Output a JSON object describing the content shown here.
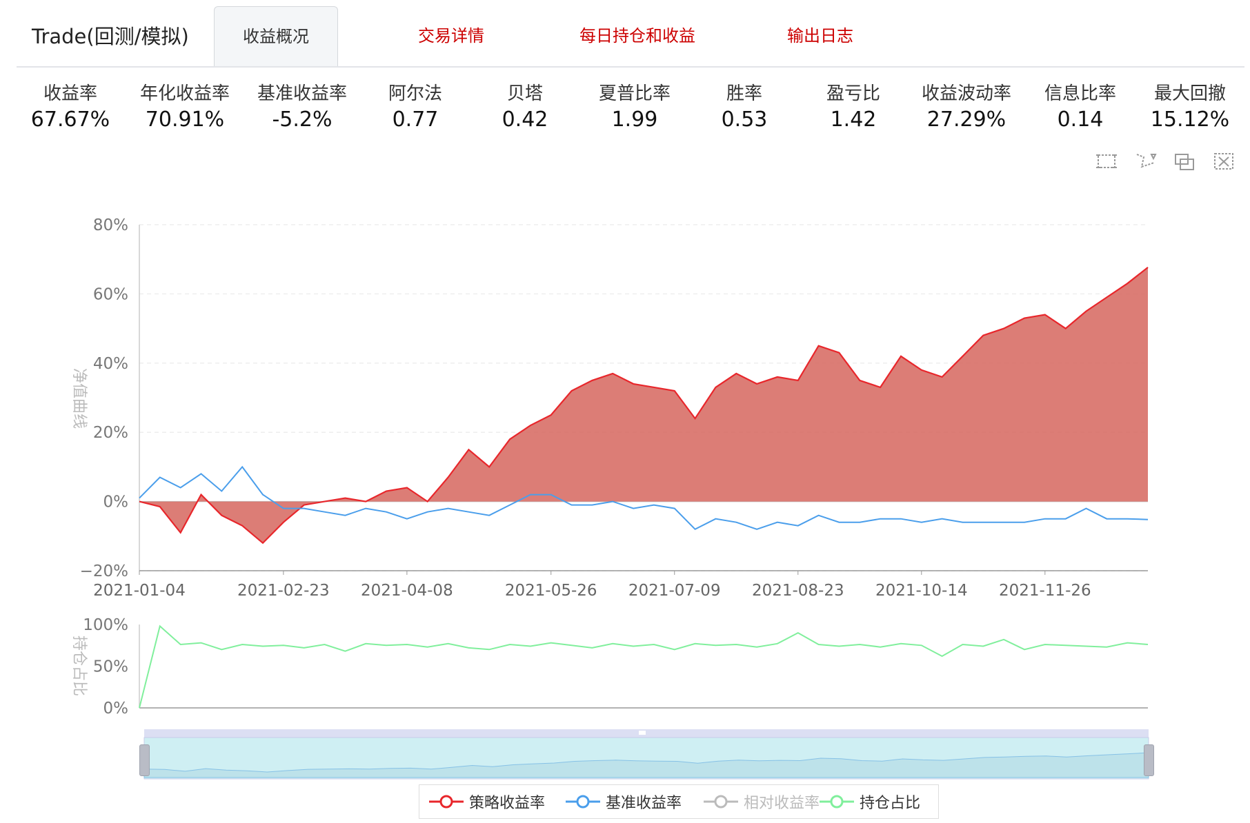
{
  "header": {
    "brand": "Trade(回测/模拟)",
    "tabs": [
      {
        "label": "收益概况",
        "active": true
      },
      {
        "label": "交易详情",
        "active": false
      },
      {
        "label": "每日持仓和收益",
        "active": false
      },
      {
        "label": "输出日志",
        "active": false
      }
    ]
  },
  "stats": [
    {
      "label": "收益率",
      "value": "67.67%"
    },
    {
      "label": "年化收益率",
      "value": "70.91%"
    },
    {
      "label": "基准收益率",
      "value": "-5.2%"
    },
    {
      "label": "阿尔法",
      "value": "0.77"
    },
    {
      "label": "贝塔",
      "value": "0.42"
    },
    {
      "label": "夏普比率",
      "value": "1.99"
    },
    {
      "label": "胜率",
      "value": "0.53"
    },
    {
      "label": "盈亏比",
      "value": "1.42"
    },
    {
      "label": "收益波动率",
      "value": "27.29%"
    },
    {
      "label": "信息比率",
      "value": "0.14"
    },
    {
      "label": "最大回撤",
      "value": "15.12%"
    }
  ],
  "toolbox": [
    "zoom-icon",
    "zoom-reset-icon",
    "restore-icon",
    "clear-icon"
  ],
  "colors": {
    "strategy": "#e8262b",
    "strategy_fill": "#d6665e",
    "benchmark": "#4a9eeb",
    "relative": "#bbbbbb",
    "position": "#80ef9c",
    "link": "#cc0000"
  },
  "chart_data": [
    {
      "type": "area",
      "ylabel": "净值曲线",
      "ylim": [
        -20,
        80
      ],
      "y_ticks": [
        "80%",
        "60%",
        "40%",
        "20%",
        "0%",
        "−20%"
      ],
      "x_ticks": [
        "2021-01-04",
        "2021-02-23",
        "2021-04-08",
        "2021-05-26",
        "2021-07-09",
        "2021-08-23",
        "2021-10-14",
        "2021-11-26"
      ],
      "x": [
        "2021-01-04",
        "2021-01-11",
        "2021-01-18",
        "2021-01-25",
        "2021-02-01",
        "2021-02-08",
        "2021-02-15",
        "2021-02-23",
        "2021-03-01",
        "2021-03-08",
        "2021-03-15",
        "2021-03-22",
        "2021-03-29",
        "2021-04-08",
        "2021-04-15",
        "2021-04-22",
        "2021-04-29",
        "2021-05-06",
        "2021-05-13",
        "2021-05-20",
        "2021-05-26",
        "2021-06-02",
        "2021-06-09",
        "2021-06-16",
        "2021-06-23",
        "2021-06-30",
        "2021-07-09",
        "2021-07-16",
        "2021-07-23",
        "2021-07-30",
        "2021-08-06",
        "2021-08-13",
        "2021-08-23",
        "2021-08-30",
        "2021-09-06",
        "2021-09-13",
        "2021-09-22",
        "2021-09-30",
        "2021-10-14",
        "2021-10-21",
        "2021-10-28",
        "2021-11-04",
        "2021-11-11",
        "2021-11-18",
        "2021-11-26",
        "2021-12-03",
        "2021-12-10",
        "2021-12-17",
        "2021-12-24",
        "2021-12-31"
      ],
      "series": [
        {
          "name": "策略收益率",
          "values": [
            0,
            -1.5,
            -9,
            2,
            -4,
            -7,
            -12,
            -6,
            -1,
            0,
            1,
            0,
            3,
            4,
            0,
            7,
            15,
            10,
            18,
            22,
            25,
            32,
            35,
            37,
            34,
            33,
            32,
            24,
            33,
            37,
            34,
            36,
            35,
            45,
            43,
            35,
            33,
            42,
            38,
            36,
            42,
            48,
            50,
            53,
            54,
            50,
            55,
            59,
            63,
            67.67
          ]
        },
        {
          "name": "基准收益率",
          "values": [
            1,
            7,
            4,
            8,
            3,
            10,
            2,
            -2,
            -2,
            -3,
            -4,
            -2,
            -3,
            -5,
            -3,
            -2,
            -3,
            -4,
            -1,
            2,
            2,
            -1,
            -1,
            0,
            -2,
            -1,
            -2,
            -8,
            -5,
            -6,
            -8,
            -6,
            -7,
            -4,
            -6,
            -6,
            -5,
            -5,
            -6,
            -5,
            -6,
            -6,
            -6,
            -6,
            -5,
            -5,
            -2,
            -5,
            -5,
            -5.2
          ]
        },
        {
          "name": "相对收益率",
          "values": []
        }
      ]
    },
    {
      "type": "line",
      "ylabel": "持仓占比",
      "ylim": [
        0,
        100
      ],
      "y_ticks": [
        "100%",
        "50%",
        "0%"
      ],
      "x": [
        "2021-01-04",
        "2021-01-11",
        "2021-01-18",
        "2021-01-25",
        "2021-02-01",
        "2021-02-08",
        "2021-02-15",
        "2021-02-23",
        "2021-03-01",
        "2021-03-08",
        "2021-03-15",
        "2021-03-22",
        "2021-03-29",
        "2021-04-08",
        "2021-04-15",
        "2021-04-22",
        "2021-04-29",
        "2021-05-06",
        "2021-05-13",
        "2021-05-20",
        "2021-05-26",
        "2021-06-02",
        "2021-06-09",
        "2021-06-16",
        "2021-06-23",
        "2021-06-30",
        "2021-07-09",
        "2021-07-16",
        "2021-07-23",
        "2021-07-30",
        "2021-08-06",
        "2021-08-13",
        "2021-08-23",
        "2021-08-30",
        "2021-09-06",
        "2021-09-13",
        "2021-09-22",
        "2021-09-30",
        "2021-10-14",
        "2021-10-21",
        "2021-10-28",
        "2021-11-04",
        "2021-11-11",
        "2021-11-18",
        "2021-11-26",
        "2021-12-03",
        "2021-12-10",
        "2021-12-17",
        "2021-12-24",
        "2021-12-31"
      ],
      "series": [
        {
          "name": "持仓占比",
          "values": [
            0,
            98,
            76,
            78,
            70,
            76,
            74,
            75,
            72,
            76,
            68,
            77,
            75,
            76,
            73,
            77,
            72,
            70,
            76,
            74,
            78,
            75,
            72,
            77,
            74,
            76,
            70,
            77,
            75,
            76,
            73,
            77,
            90,
            76,
            74,
            76,
            73,
            77,
            75,
            62,
            76,
            74,
            82,
            70,
            76,
            75,
            74,
            73,
            78,
            76
          ]
        }
      ]
    }
  ],
  "legend": [
    {
      "name": "策略收益率",
      "color": "#e8262b",
      "active": true
    },
    {
      "name": "基准收益率",
      "color": "#4a9eeb",
      "active": true
    },
    {
      "name": "相对收益率",
      "color": "#bbbbbb",
      "active": false
    },
    {
      "name": "持仓占比",
      "color": "#80ef9c",
      "active": true
    }
  ]
}
